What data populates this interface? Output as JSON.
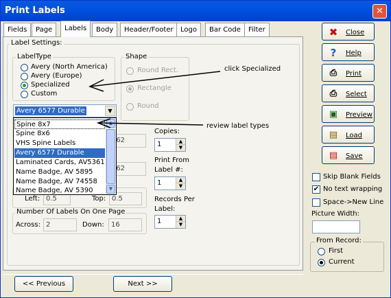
{
  "window": {
    "title": "Print Labels",
    "close_glyph": "✕"
  },
  "tabs": [
    "Fields",
    "Page",
    "Labels",
    "Body",
    "Header/Footer",
    "Logo",
    "Bar Code",
    "Filter"
  ],
  "active_tab": "Labels",
  "label_settings": {
    "title": "Label Settings:",
    "label_type": {
      "title": "LabelType",
      "options": [
        "Avery (North America)",
        "Avery (Europe)",
        "Specialized",
        "Custom"
      ],
      "selected": "Specialized"
    },
    "shape": {
      "title": "Shape",
      "options": [
        "Round Rect.",
        "Rectangle",
        "Round"
      ],
      "selected": "Rectangle",
      "disabled": true
    },
    "label_combo": {
      "value": "Avery 6577 Durable"
    },
    "dropdown_items": [
      "Spine 8x7",
      "Spine 8x6",
      "VHS Spine Labels",
      "Avery 6577 Durable",
      "Laminated Cards, AV5361",
      "Name Badge, AV 5895",
      "Name Badge, AV 74558",
      "Name Badge, AV 5390"
    ],
    "dropdown_selected": "Avery 6577 Durable",
    "hidden_values": {
      "width_partial": "62",
      "height_partial": "62"
    },
    "margins": {
      "left_label": "Left:",
      "left_value": "0.5",
      "top_label": "Top:",
      "top_value": "0.5"
    },
    "copies": {
      "label": "Copies:",
      "value": "1"
    },
    "print_from": {
      "label": "Print From Label #:",
      "value": "1"
    },
    "records_per": {
      "label": "Records Per Label:",
      "value": "1"
    },
    "labels_on_page": {
      "title": "Number Of Labels On One Page",
      "across_label": "Across:",
      "across_value": "2",
      "down_label": "Down:",
      "down_value": "16"
    }
  },
  "annotations": {
    "specialized": "click Specialized",
    "review": "review label types"
  },
  "side_buttons": [
    {
      "label": "Close",
      "icon": "close-icon"
    },
    {
      "label": "Help",
      "icon": "help-icon"
    },
    {
      "label": "Print",
      "icon": "print-icon"
    },
    {
      "label": "Select",
      "icon": "select-icon"
    },
    {
      "label": "Preview",
      "icon": "preview-icon"
    },
    {
      "label": "Load",
      "icon": "load-icon"
    },
    {
      "label": "Save",
      "icon": "save-icon"
    }
  ],
  "options": {
    "skip_blank": {
      "label": "Skip Blank Fields",
      "checked": false
    },
    "no_wrap": {
      "label": "No text wrapping",
      "checked": true
    },
    "space_newline": {
      "label": "Space->New Line",
      "checked": false
    },
    "picture_width": {
      "label": "Picture Width:",
      "value": ""
    }
  },
  "from_record": {
    "title": "From Record:",
    "options": [
      "First",
      "Current"
    ],
    "selected": "Current"
  },
  "nav": {
    "previous": "<< Previous",
    "next": "Next >>"
  }
}
